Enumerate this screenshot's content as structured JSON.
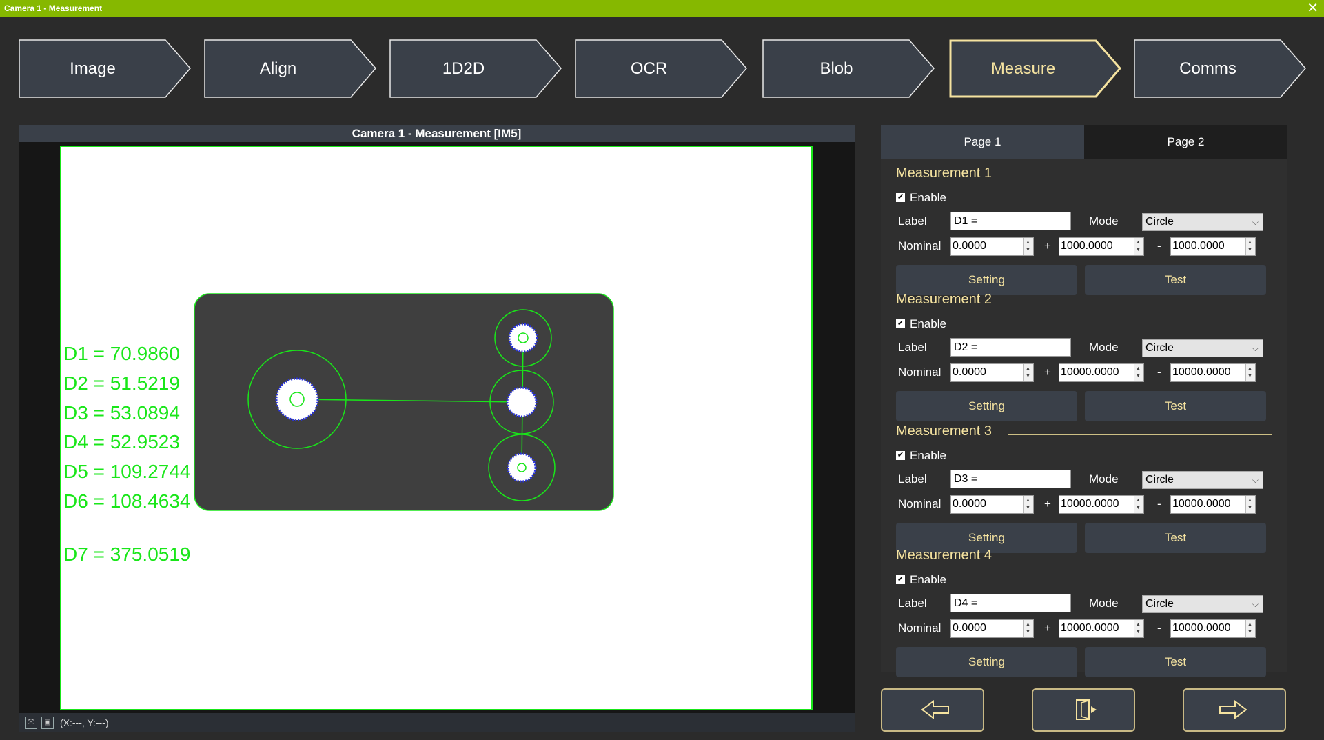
{
  "window": {
    "title": "Camera 1 - Measurement",
    "close_icon": "close-icon"
  },
  "steps": [
    {
      "label": "Image",
      "active": false
    },
    {
      "label": "Align",
      "active": false
    },
    {
      "label": "1D2D",
      "active": false
    },
    {
      "label": "OCR",
      "active": false
    },
    {
      "label": "Blob",
      "active": false
    },
    {
      "label": "Measure",
      "active": true
    },
    {
      "label": "Comms",
      "active": false
    }
  ],
  "camera": {
    "title": "Camera 1 -  Measurement  [IM5]",
    "overlay_labels": [
      "D1 = 70.9860",
      "D2 = 51.5219",
      "D3 = 53.0894",
      "D4 = 52.9523",
      "D5 = 109.2744",
      "D6 = 108.4634",
      "D7 = 375.0519"
    ],
    "coords": "(X:---, Y:---)"
  },
  "tabs": [
    {
      "label": "Page 1",
      "selected": true
    },
    {
      "label": "Page 2",
      "selected": false
    }
  ],
  "field_labels": {
    "enable": "Enable",
    "label": "Label",
    "mode": "Mode",
    "nominal": "Nominal",
    "plus": "+",
    "minus": "-",
    "setting": "Setting",
    "test": "Test"
  },
  "measurements": [
    {
      "title": "Measurement 1",
      "enabled": true,
      "label": "D1 =",
      "mode": "Circle",
      "nominal": "0.0000",
      "plus": "1000.0000",
      "minus": "1000.0000"
    },
    {
      "title": "Measurement 2",
      "enabled": true,
      "label": "D2 =",
      "mode": "Circle",
      "nominal": "0.0000",
      "plus": "10000.0000",
      "minus": "10000.0000"
    },
    {
      "title": "Measurement 3",
      "enabled": true,
      "label": "D3 =",
      "mode": "Circle",
      "nominal": "0.0000",
      "plus": "10000.0000",
      "minus": "10000.0000"
    },
    {
      "title": "Measurement 4",
      "enabled": true,
      "label": "D4 =",
      "mode": "Circle",
      "nominal": "0.0000",
      "plus": "10000.0000",
      "minus": "10000.0000"
    }
  ],
  "nav": {
    "back_icon": "arrow-left-icon",
    "exit_icon": "exit-door-icon",
    "next_icon": "arrow-right-icon"
  },
  "colors": {
    "title_bar": "#86b800",
    "accent": "#f5e3a0",
    "overlay_green": "#19e619",
    "button": "#3a4049"
  }
}
